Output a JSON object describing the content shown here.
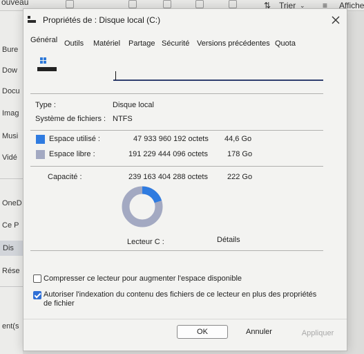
{
  "background": {
    "toolbar": {
      "partial_left": "ouveau",
      "sort_label": "Trier",
      "view_label": "Affiche"
    },
    "sidebar": [
      "Bure",
      "Dow",
      "Docu",
      "Imag",
      "Musi",
      "Vidé",
      "OneD",
      "Ce P",
      "Dis",
      "Rése",
      "ent(s"
    ]
  },
  "dialog": {
    "title": "Propriétés de : Disque local (C:)",
    "tabs": [
      "Général",
      "Outils",
      "Matériel",
      "Partage",
      "Sécurité",
      "Versions précédentes",
      "Quota"
    ],
    "active_tab": "Général",
    "name_value": "",
    "type_label": "Type :",
    "type_value": "Disque local",
    "fs_label": "Système de fichiers :",
    "fs_value": "NTFS",
    "used": {
      "label": "Espace utilisé :",
      "bytes": "47 933 960 192 octets",
      "size": "44,6 Go",
      "color": "#2f7be0"
    },
    "free": {
      "label": "Espace libre :",
      "bytes": "191 229 444 096 octets",
      "size": "178 Go",
      "color": "#a3a9c2"
    },
    "capacity": {
      "label": "Capacité :",
      "bytes": "239 163 404 288 octets",
      "size": "222 Go"
    },
    "used_fraction": 0.2,
    "drive_label": "Lecteur C :",
    "details_label": "Détails",
    "compress_label": "Compresser ce lecteur pour augmenter l'espace disponible",
    "compress_checked": false,
    "index_label": "Autoriser l'indexation du contenu des fichiers de ce lecteur en plus des propriétés de fichier",
    "index_checked": true,
    "buttons": {
      "ok": "OK",
      "cancel": "Annuler",
      "apply": "Appliquer"
    }
  }
}
